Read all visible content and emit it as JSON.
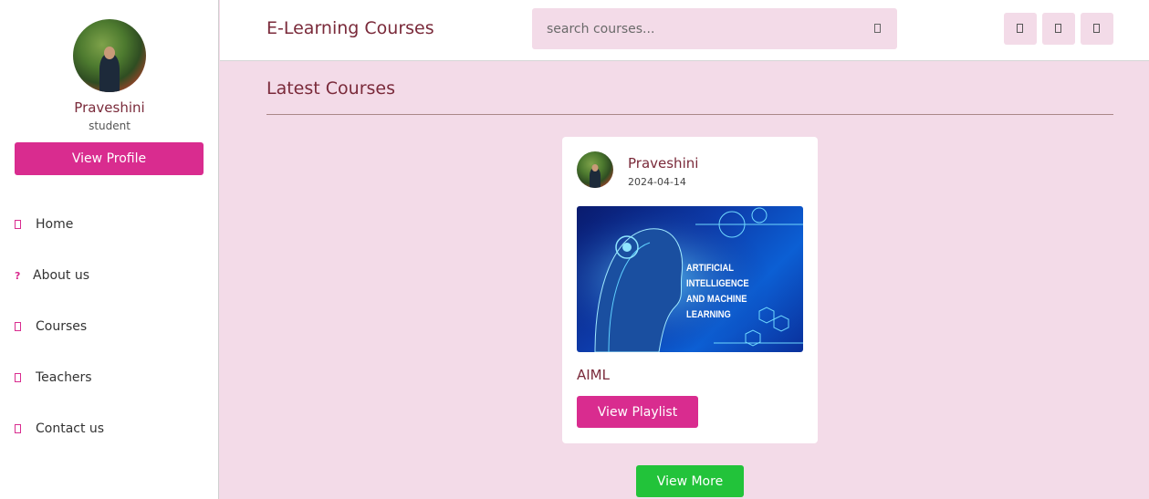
{
  "sidebar": {
    "profile": {
      "name": "Praveshini",
      "role": "student",
      "button_label": "View Profile"
    },
    "items": [
      {
        "label": "Home",
        "icon": "home-icon"
      },
      {
        "label": "About us",
        "icon": "question-icon",
        "glyph": "?"
      },
      {
        "label": "Courses",
        "icon": "courses-icon"
      },
      {
        "label": "Teachers",
        "icon": "teachers-icon"
      },
      {
        "label": "Contact us",
        "icon": "contact-icon"
      }
    ]
  },
  "header": {
    "logo": "E-Learning Courses",
    "search": {
      "placeholder": "search courses..."
    },
    "buttons": [
      "menu-icon",
      "user-icon",
      "theme-toggle-icon"
    ]
  },
  "main": {
    "section_title": "Latest Courses",
    "courses": [
      {
        "tutor_name": "Praveshini",
        "date": "2024-04-14",
        "thumbnail_text_line1": "ARTIFICIAL INTELLIGENCE",
        "thumbnail_text_line2": "AND MACHINE LEARNING",
        "title": "AIML",
        "button_label": "View Playlist"
      }
    ],
    "more_button_label": "View More"
  },
  "colors": {
    "accent": "#d92c8f",
    "background": "#f3dbe8",
    "title_text": "#7a2a3a",
    "more_button": "#22c33a"
  }
}
